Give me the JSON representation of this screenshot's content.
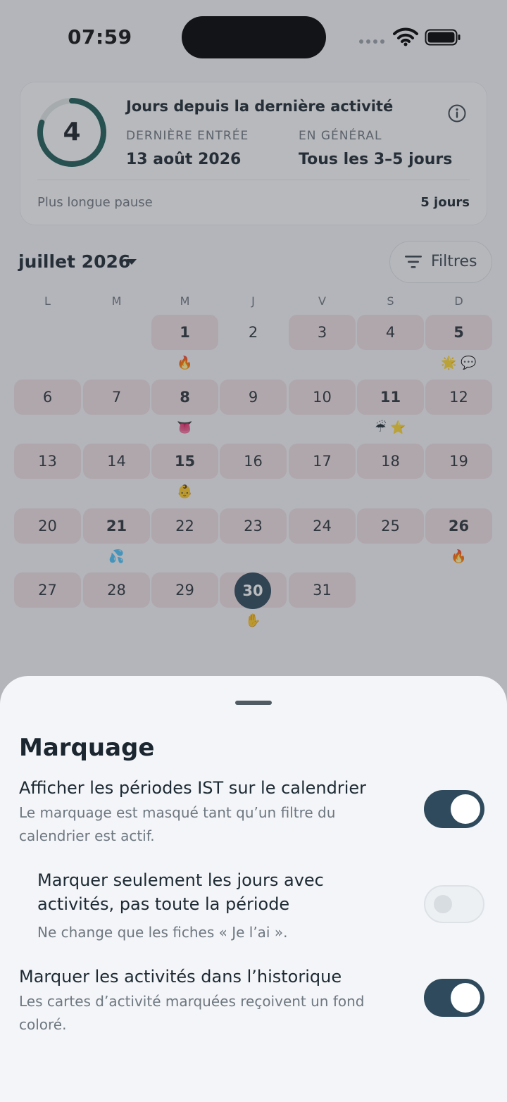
{
  "status_bar": {
    "time": "07:59"
  },
  "activity_card": {
    "days_value": "4",
    "ring_progress": 0.8,
    "title": "Jours depuis la dernière activité",
    "last_entry_label": "DERNIÈRE ENTRÉE",
    "last_entry_value": "13 août 2026",
    "general_label": "EN GÉNÉRAL",
    "general_value": "Tous les 3–5 jours",
    "longest_pause_label": "Plus longue pause",
    "longest_pause_value": "5 jours"
  },
  "calendar": {
    "month_label": "juillet 2026",
    "filter_label": "Filtres",
    "weekdays": [
      "L",
      "M",
      "M",
      "J",
      "V",
      "S",
      "D"
    ],
    "days": [
      {
        "n": "1",
        "col": 2,
        "row": 0,
        "marked": true,
        "bold": true,
        "emoji": "🔥"
      },
      {
        "n": "2",
        "col": 3,
        "row": 0,
        "marked": false,
        "bold": false,
        "emoji": ""
      },
      {
        "n": "3",
        "col": 4,
        "row": 0,
        "marked": true,
        "bold": false,
        "emoji": ""
      },
      {
        "n": "4",
        "col": 5,
        "row": 0,
        "marked": true,
        "bold": false,
        "emoji": ""
      },
      {
        "n": "5",
        "col": 6,
        "row": 0,
        "marked": true,
        "bold": true,
        "emoji": "🌟 💬"
      },
      {
        "n": "6",
        "col": 0,
        "row": 1,
        "marked": true,
        "bold": false,
        "emoji": ""
      },
      {
        "n": "7",
        "col": 1,
        "row": 1,
        "marked": true,
        "bold": false,
        "emoji": ""
      },
      {
        "n": "8",
        "col": 2,
        "row": 1,
        "marked": true,
        "bold": true,
        "emoji": "👅"
      },
      {
        "n": "9",
        "col": 3,
        "row": 1,
        "marked": true,
        "bold": false,
        "emoji": ""
      },
      {
        "n": "10",
        "col": 4,
        "row": 1,
        "marked": true,
        "bold": false,
        "emoji": ""
      },
      {
        "n": "11",
        "col": 5,
        "row": 1,
        "marked": true,
        "bold": true,
        "emoji": "☔ ⭐"
      },
      {
        "n": "12",
        "col": 6,
        "row": 1,
        "marked": true,
        "bold": false,
        "emoji": ""
      },
      {
        "n": "13",
        "col": 0,
        "row": 2,
        "marked": true,
        "bold": false,
        "emoji": ""
      },
      {
        "n": "14",
        "col": 1,
        "row": 2,
        "marked": true,
        "bold": false,
        "emoji": ""
      },
      {
        "n": "15",
        "col": 2,
        "row": 2,
        "marked": true,
        "bold": true,
        "emoji": "👶"
      },
      {
        "n": "16",
        "col": 3,
        "row": 2,
        "marked": true,
        "bold": false,
        "emoji": ""
      },
      {
        "n": "17",
        "col": 4,
        "row": 2,
        "marked": true,
        "bold": false,
        "emoji": ""
      },
      {
        "n": "18",
        "col": 5,
        "row": 2,
        "marked": true,
        "bold": false,
        "emoji": ""
      },
      {
        "n": "19",
        "col": 6,
        "row": 2,
        "marked": true,
        "bold": false,
        "emoji": ""
      },
      {
        "n": "20",
        "col": 0,
        "row": 3,
        "marked": true,
        "bold": false,
        "emoji": ""
      },
      {
        "n": "21",
        "col": 1,
        "row": 3,
        "marked": true,
        "bold": true,
        "emoji": "💦"
      },
      {
        "n": "22",
        "col": 2,
        "row": 3,
        "marked": true,
        "bold": false,
        "emoji": ""
      },
      {
        "n": "23",
        "col": 3,
        "row": 3,
        "marked": true,
        "bold": false,
        "emoji": ""
      },
      {
        "n": "24",
        "col": 4,
        "row": 3,
        "marked": true,
        "bold": false,
        "emoji": ""
      },
      {
        "n": "25",
        "col": 5,
        "row": 3,
        "marked": true,
        "bold": false,
        "emoji": ""
      },
      {
        "n": "26",
        "col": 6,
        "row": 3,
        "marked": true,
        "bold": true,
        "emoji": "🔥"
      },
      {
        "n": "27",
        "col": 0,
        "row": 4,
        "marked": true,
        "bold": false,
        "emoji": ""
      },
      {
        "n": "28",
        "col": 1,
        "row": 4,
        "marked": true,
        "bold": false,
        "emoji": ""
      },
      {
        "n": "29",
        "col": 2,
        "row": 4,
        "marked": true,
        "bold": false,
        "emoji": ""
      },
      {
        "n": "30",
        "col": 3,
        "row": 4,
        "marked": true,
        "bold": true,
        "today": true,
        "emoji": "✋"
      },
      {
        "n": "31",
        "col": 4,
        "row": 4,
        "marked": true,
        "bold": false,
        "emoji": ""
      }
    ]
  },
  "sheet": {
    "title": "Marquage",
    "options": [
      {
        "title": "Afficher les périodes IST sur le calendrier",
        "subtitle": "Le marquage est masqué tant qu’un filtre du calendrier est actif.",
        "enabled": true
      },
      {
        "title": "Marquer seulement les jours avec activités, pas toute la période",
        "subtitle": "Ne change que les fiches « Je l’ai ».",
        "enabled": false
      },
      {
        "title": "Marquer les activités dans l’historique",
        "subtitle": "Les cartes d’activité marquées reçoivent un fond coloré.",
        "enabled": true
      }
    ]
  },
  "colors": {
    "accent": "#2e4a5c",
    "ring": "#1f5b57",
    "marked_day": "#eee0e2"
  }
}
